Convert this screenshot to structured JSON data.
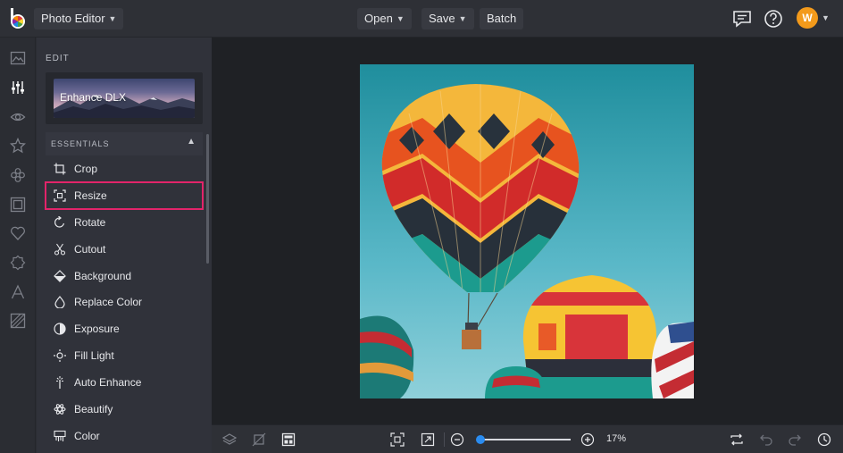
{
  "app": {
    "menu_label": "Photo Editor"
  },
  "toolbar": {
    "open_label": "Open",
    "save_label": "Save",
    "batch_label": "Batch"
  },
  "user": {
    "avatar_initial": "W"
  },
  "rail": {
    "icons": [
      "image-icon",
      "sliders-icon",
      "eye-icon",
      "star-icon",
      "flower-icon",
      "frame-icon",
      "heart-icon",
      "badge-icon",
      "text-icon",
      "texture-icon"
    ],
    "active": "sliders-icon"
  },
  "panel": {
    "section_label": "EDIT",
    "enhance_label": "Enhance DLX",
    "essentials_label": "ESSENTIALS",
    "tools": [
      {
        "label": "Crop",
        "icon": "crop-icon"
      },
      {
        "label": "Resize",
        "icon": "resize-icon"
      },
      {
        "label": "Rotate",
        "icon": "rotate-icon"
      },
      {
        "label": "Cutout",
        "icon": "scissors-icon"
      },
      {
        "label": "Background",
        "icon": "background-icon"
      },
      {
        "label": "Replace Color",
        "icon": "droplet-icon"
      },
      {
        "label": "Exposure",
        "icon": "exposure-icon"
      },
      {
        "label": "Fill Light",
        "icon": "sun-icon"
      },
      {
        "label": "Auto Enhance",
        "icon": "wand-icon"
      },
      {
        "label": "Beautify",
        "icon": "atom-icon"
      },
      {
        "label": "Color",
        "icon": "palette-icon"
      }
    ],
    "highlighted_tool": "Resize"
  },
  "zoom": {
    "percent": "17%",
    "level": 0.17
  },
  "colors": {
    "accent": "#2a8cf0",
    "highlight": "#e2246a",
    "avatar": "#f39a1b"
  }
}
